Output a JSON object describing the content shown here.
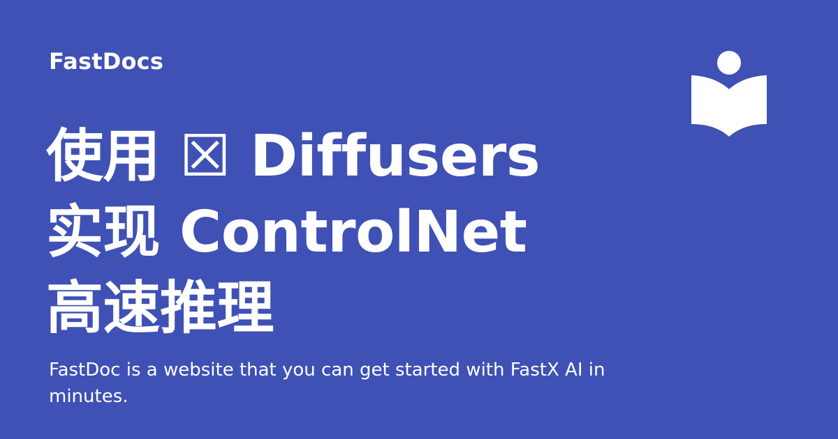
{
  "brand": {
    "name": "FastDocs"
  },
  "title": {
    "lines": [
      "使用 ☒ Diffusers",
      "实现 ControlNet",
      "高速推理"
    ]
  },
  "subtitle": "FastDoc is a website that you can get started with FastX AI in minutes.",
  "logo": {
    "icon": "reader-book-icon"
  },
  "colors": {
    "background": "#3f51b5",
    "foreground": "#ffffff"
  }
}
